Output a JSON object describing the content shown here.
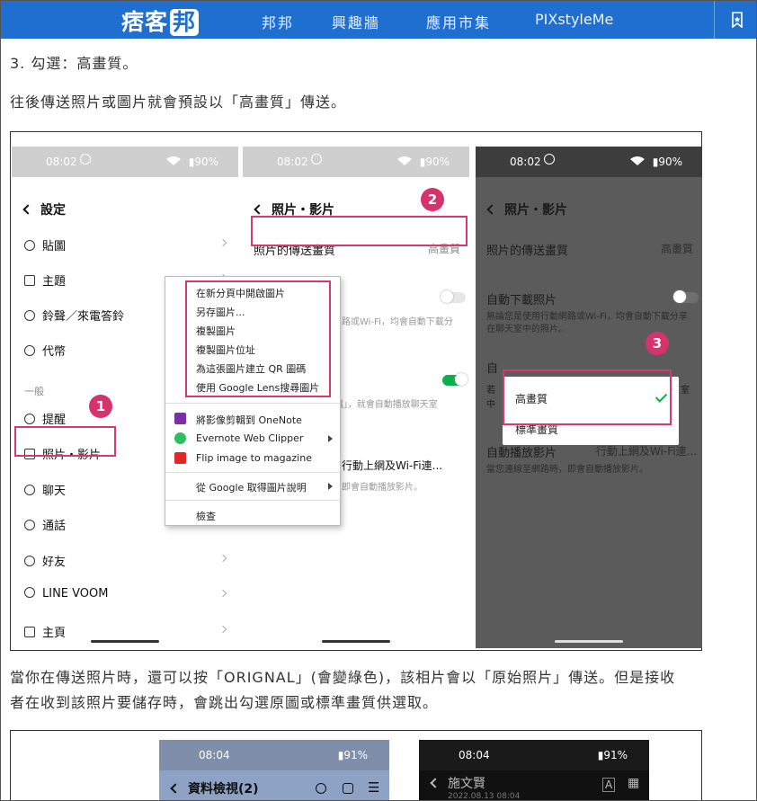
{
  "site": {
    "logo_text": "痞客",
    "logo_badge": "邦",
    "nav": [
      "邦邦",
      "興趣牆",
      "應用市集",
      "PIXstyleMe"
    ]
  },
  "article": {
    "step3": "3. 勾選：高畫質。",
    "line2": "往後傳送照片或圖片就會預設以「高畫質」傳送。",
    "line3a": "當你在傳送照片時，還可以按「ORIGNAL」(會變綠色)，該相片會以「原始照片」傳送。但是接收",
    "line3b": "者在收到該照片要儲存時，會跳出勾選原圖或標準畫質供選取。"
  },
  "screenshot1": {
    "status_time": "08:02",
    "status_battery": "90%",
    "panel1": {
      "title": "設定",
      "items": [
        "貼圖",
        "主題",
        "鈴聲／來電答鈴",
        "代幣"
      ],
      "section": "一般",
      "items2": [
        "提醒",
        "照片・影片",
        "聊天",
        "通話",
        "好友",
        "LINE VOOM",
        "主頁"
      ],
      "badge": "1"
    },
    "panel2": {
      "title": "照片・影片",
      "row1_label": "照片的傳送畫質",
      "row1_value": "高畫質",
      "row2_desc": "路或Wi-Fi，均會自動下載分",
      "row3_desc": "F檔」，就會自動播放聊天室",
      "row4_label": "行動上網及Wi-Fi連...",
      "row4_desc": "即會自動播放影片。",
      "badge": "2"
    },
    "panel3": {
      "title": "照片・影片",
      "row1_label": "照片的傳送畫質",
      "row1_value": "高畫質",
      "row2_label": "自動下載照片",
      "row2_desc": "無論您是使用行動網路或Wi-Fi，均會自動下載分享在聊天室中的照片。",
      "row3_partial_a": "自",
      "row3_partial_b": "若",
      "row3_partial_c": "中",
      "row3_partial_d": "室",
      "row4_label": "自動播放影片",
      "row4_value": "行動上網及Wi-Fi連...",
      "row4_desc": "當您連線至網路時，即會自動播放影片。",
      "dialog_opt1": "高畫質",
      "dialog_opt2": "標準畫質",
      "badge": "3"
    },
    "context_menu": {
      "group1": [
        "在新分頁中開啟圖片",
        "另存圖片...",
        "複製圖片",
        "複製圖片位址",
        "為這張圖片建立 QR 圖碼",
        "使用 Google Lens搜尋圖片"
      ],
      "group2": [
        "將影像剪輯到 OneNote",
        "Evernote Web Clipper",
        "Flip image to magazine"
      ],
      "group3": [
        "從 Google 取得圖片說明"
      ],
      "group4": [
        "檢查"
      ]
    }
  },
  "screenshot2": {
    "left_time": "08:04",
    "left_battery": "91%",
    "left_title": "資料檢視(2)",
    "right_time": "08:04",
    "right_battery": "91%",
    "right_title": "施文賢",
    "right_subtitle": "2022.08.13 08:04"
  },
  "colors": {
    "nav_bg": "#1f6fd0",
    "highlight": "#d63a6a",
    "badge": "#d6336c",
    "toggle_on": "#0bb04a"
  }
}
